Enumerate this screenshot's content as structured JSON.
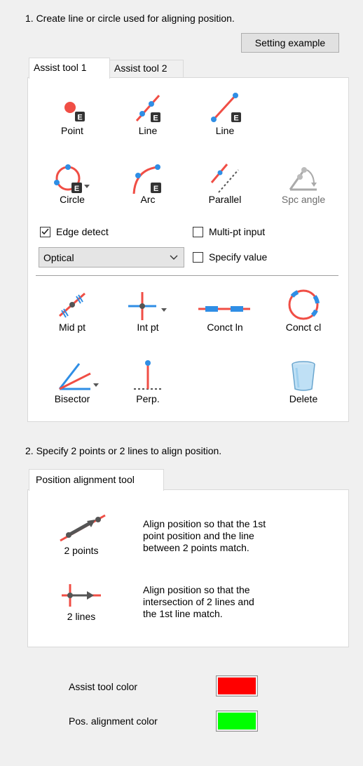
{
  "step1": {
    "label": "1. Create line or circle used for aligning position.",
    "setting_example_button": "Setting example"
  },
  "assist_tabs": [
    "Assist tool 1",
    "Assist tool 2"
  ],
  "create_tools": [
    {
      "label": "Point",
      "icon": "point-icon"
    },
    {
      "label": "Line",
      "icon": "line-2pt-icon"
    },
    {
      "label": "Line",
      "icon": "line-end-icon"
    },
    {
      "label": "Circle",
      "icon": "circle-icon"
    },
    {
      "label": "Arc",
      "icon": "arc-icon"
    },
    {
      "label": "Parallel",
      "icon": "parallel-icon"
    },
    {
      "label": "Spc angle",
      "icon": "specify-angle-icon",
      "disabled": true
    }
  ],
  "edge_detect": {
    "label": "Edge detect",
    "checked": true
  },
  "multi_pt_input": {
    "label": "Multi-pt input",
    "checked": false
  },
  "detect_mode": {
    "selected": "Optical"
  },
  "specify_value": {
    "label": "Specify value",
    "checked": false
  },
  "derive_tools": [
    {
      "label": "Mid pt",
      "icon": "midpoint-icon"
    },
    {
      "label": "Int pt",
      "icon": "intersection-icon"
    },
    {
      "label": "Conct ln",
      "icon": "concentric-line-icon"
    },
    {
      "label": "Conct cl",
      "icon": "concentric-circle-icon"
    },
    {
      "label": "Bisector",
      "icon": "bisector-icon"
    },
    {
      "label": "Perp.",
      "icon": "perpendicular-icon"
    },
    {
      "label": "Delete",
      "icon": "trash-icon"
    }
  ],
  "step2": {
    "label": "2. Specify 2 points or 2 lines to align position.",
    "tab": "Position alignment tool",
    "tools": [
      {
        "label": "2 points",
        "description": [
          "Align position so that the 1st",
          "point position and the line",
          "between 2 points match."
        ]
      },
      {
        "label": "2 lines",
        "description": [
          "Align position so that the",
          "intersection of 2 lines and",
          "the 1st line match."
        ]
      }
    ]
  },
  "colors": {
    "assist_label": "Assist tool color",
    "assist_color": "#ff0000",
    "alignment_label": "Pos. alignment color",
    "alignment_color": "#00ff00",
    "tool_red": "#f04e45",
    "tool_blue": "#2f8ee5"
  }
}
